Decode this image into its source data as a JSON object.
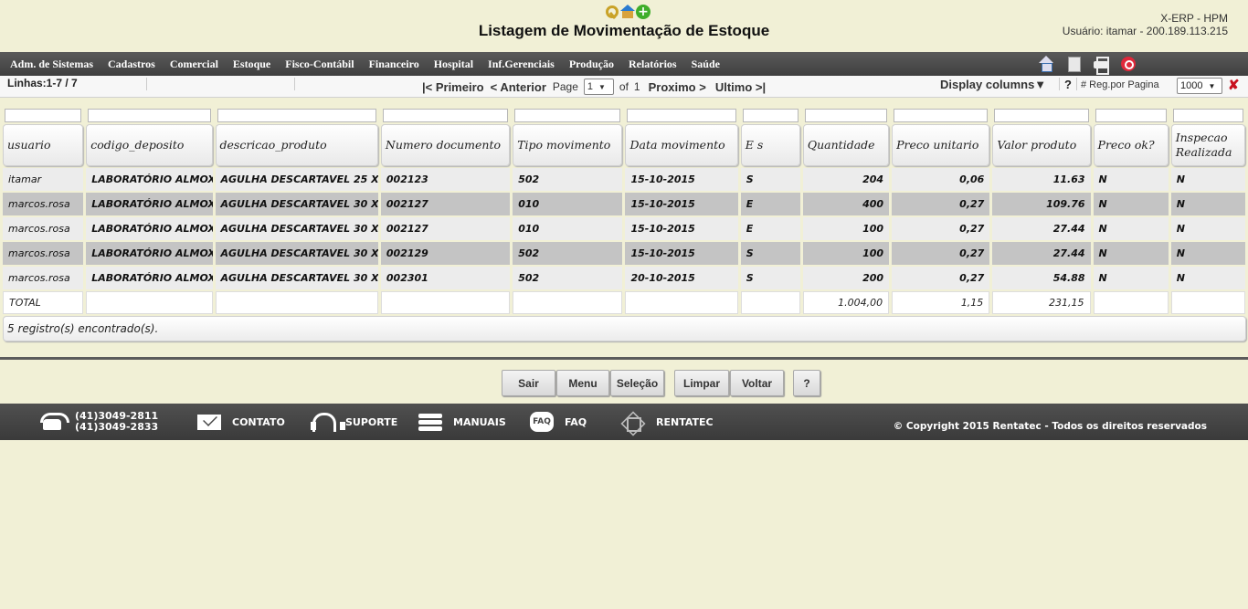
{
  "header": {
    "title": "Listagem de Movimentação de Estoque",
    "system_name": "X-ERP - HPM",
    "user_info": "Usuário: itamar - 200.189.113.215",
    "icons": [
      "key-icon",
      "house-icon",
      "add-icon"
    ]
  },
  "menu": {
    "items": [
      "Adm. de Sistemas",
      "Cadastros",
      "Comercial",
      "Estoque",
      "Fisco-Contábil",
      "Financeiro",
      "Hospital",
      "Inf.Gerenciais",
      "Produção",
      "Relatórios",
      "Saúde"
    ],
    "tools": [
      "home-icon",
      "document-icon",
      "printer-icon",
      "power-icon"
    ]
  },
  "pager": {
    "lines": "Linhas:1-7 / 7",
    "first": "|< Primeiro",
    "previous": "< Anterior",
    "page_label": "Page",
    "page_value": "1",
    "of_label": "of",
    "total_pages": "1",
    "next": "Proximo >",
    "last": "Ultimo >|",
    "display_columns": "Display columns▼",
    "help": "?",
    "reg_label": "# Reg.por Pagina",
    "reg_value": "1000",
    "close": "✘"
  },
  "table": {
    "columns": [
      "usuario",
      "codigo_deposito",
      "descricao_produto",
      "Numero documento",
      "Tipo movimento",
      "Data movimento",
      "E s",
      "Quantidade",
      "Preco unitario",
      "Valor produto",
      "Preco ok?",
      "Inspecao Realizada"
    ],
    "rows": [
      [
        "itamar",
        "LABORATÓRIO ALMOX",
        "AGULHA DESCARTAVEL 25 X 6",
        "002123",
        "502",
        "15-10-2015",
        "S",
        "204",
        "0,06",
        "11.63",
        "N",
        "N"
      ],
      [
        "marcos.rosa",
        "LABORATÓRIO ALMOX",
        "AGULHA DESCARTAVEL 30 X 8",
        "002127",
        "010",
        "15-10-2015",
        "E",
        "400",
        "0,27",
        "109.76",
        "N",
        "N"
      ],
      [
        "marcos.rosa",
        "LABORATÓRIO ALMOX",
        "AGULHA DESCARTAVEL 30 X 8",
        "002127",
        "010",
        "15-10-2015",
        "E",
        "100",
        "0,27",
        "27.44",
        "N",
        "N"
      ],
      [
        "marcos.rosa",
        "LABORATÓRIO ALMOX",
        "AGULHA DESCARTAVEL 30 X 8",
        "002129",
        "502",
        "15-10-2015",
        "S",
        "100",
        "0,27",
        "27.44",
        "N",
        "N"
      ],
      [
        "marcos.rosa",
        "LABORATÓRIO ALMOX",
        "AGULHA DESCARTAVEL 30 X 8",
        "002301",
        "502",
        "20-10-2015",
        "S",
        "200",
        "0,27",
        "54.88",
        "N",
        "N"
      ]
    ],
    "total": [
      "TOTAL",
      "",
      "",
      "",
      "",
      "",
      "",
      "1.004,00",
      "1,15",
      "231,15",
      "",
      ""
    ],
    "records": "5 registro(s) encontrado(s)."
  },
  "buttons": [
    "Sair",
    "Menu",
    "Seleção",
    "Limpar",
    "Voltar",
    "?"
  ],
  "footer": {
    "phone1": "(41)3049-2811",
    "phone2": "(41)3049-2833",
    "contact": "CONTATO",
    "support": "SUPORTE",
    "manuals": "MANUAIS",
    "faq": "FAQ",
    "faq_icon_text": "FAQ",
    "rentatec": "RENTATEC",
    "copyright": "© Copyright 2015 Rentatec - Todos os direitos reservados"
  }
}
